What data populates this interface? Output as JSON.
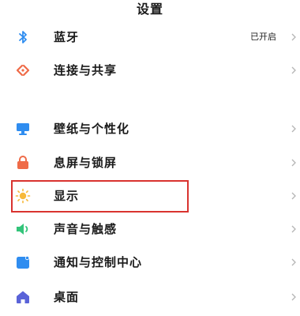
{
  "header": {
    "title": "设置"
  },
  "rows": [
    {
      "label": "蓝牙",
      "value": "已开启",
      "icon": "bluetooth-icon"
    },
    {
      "label": "连接与共享",
      "icon": "connection-share-icon"
    },
    {
      "label": "壁纸与个性化",
      "icon": "wallpaper-icon"
    },
    {
      "label": "息屏与锁屏",
      "icon": "lock-screen-icon"
    },
    {
      "label": "显示",
      "icon": "sun-icon"
    },
    {
      "label": "声音与触感",
      "icon": "speaker-icon"
    },
    {
      "label": "通知与控制中心",
      "icon": "notification-icon"
    },
    {
      "label": "桌面",
      "icon": "home-icon"
    }
  ],
  "colors": {
    "bluetooth": "#2f8df0",
    "connection": "#ef6b48",
    "wallpaper": "#2f8df0",
    "lock": "#ef6b48",
    "sun": "#f7b93a",
    "speaker": "#33c47a",
    "notification": "#2f8df0",
    "home": "#5a63d8",
    "highlight_border": "#d9332f"
  }
}
